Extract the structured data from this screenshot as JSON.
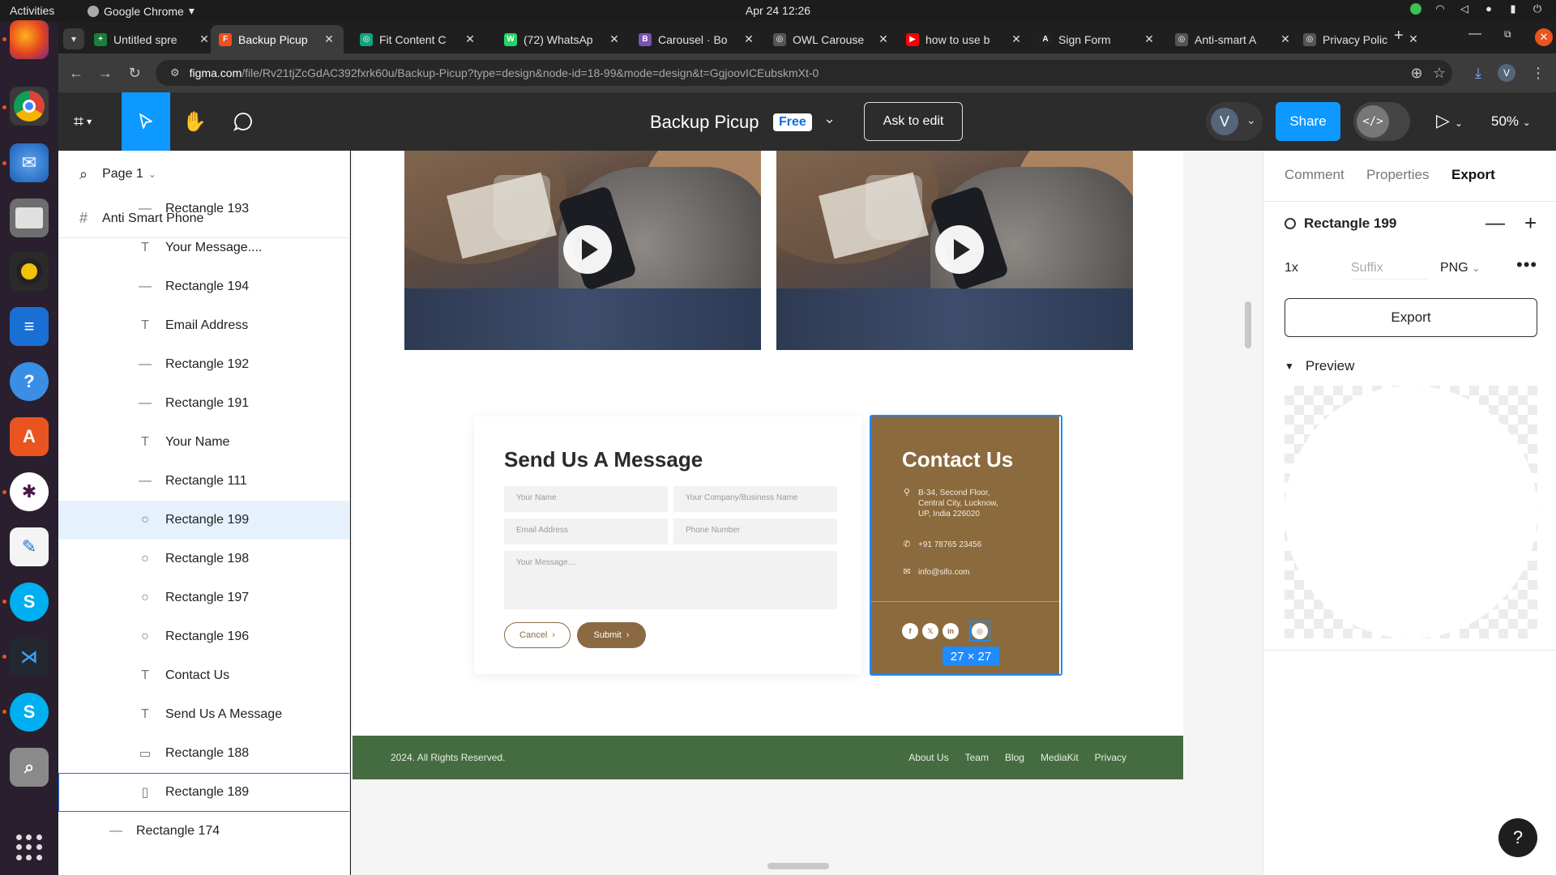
{
  "topbar": {
    "activities": "Activities",
    "app_name": "Google Chrome",
    "clock": "Apr 24  12:26"
  },
  "dock": {
    "items": [
      "firefox-icon",
      "chrome-icon",
      "thunderbird-icon",
      "files-icon",
      "rhythmbox-icon",
      "writer-icon",
      "help-icon",
      "software-icon",
      "slack-icon",
      "text-editor-icon",
      "skype-icon",
      "vscode-icon",
      "skype-icon",
      "search-icon"
    ]
  },
  "browser": {
    "tabs": [
      {
        "title": "Untitled spre",
        "color": "#188038",
        "glyph": "+"
      },
      {
        "title": "Backup Picup",
        "color": "#f24e1e",
        "glyph": "F",
        "active": true
      },
      {
        "title": "Fit Content C",
        "color": "#10a37f",
        "glyph": "◎"
      },
      {
        "title": "(72) WhatsAp",
        "color": "#25d366",
        "glyph": "W"
      },
      {
        "title": "Carousel · Bo",
        "color": "#7952b3",
        "glyph": "B"
      },
      {
        "title": "OWL Carouse",
        "color": "#555555",
        "glyph": "◎"
      },
      {
        "title": "how to use b",
        "color": "#ff0000",
        "glyph": "▶"
      },
      {
        "title": "Sign Form",
        "color": "#222222",
        "glyph": "A"
      },
      {
        "title": "Anti-smart A",
        "color": "#555555",
        "glyph": "◎"
      },
      {
        "title": "Privacy Polic",
        "color": "#555555",
        "glyph": "◎"
      }
    ],
    "url_host": "figma.com",
    "url_path": "/file/Rv21tjZcGdAC392fxrk60u/Backup-Picup?type=design&node-id=18-99&mode=design&t=GgjoovICEubskmXt-0",
    "profile_initial": "V"
  },
  "figma": {
    "file_title": "Backup Picup",
    "plan_badge": "Free",
    "ask_to_edit": "Ask to edit",
    "avatar_initial": "V",
    "share": "Share",
    "dev_mode": "</>",
    "zoom": "50%"
  },
  "layers": {
    "page": "Page 1",
    "frame": "Anti Smart Phone",
    "items": [
      {
        "name": "Rectangle 193",
        "type": "line"
      },
      {
        "name": "Your Message....",
        "type": "text"
      },
      {
        "name": "Rectangle 194",
        "type": "line"
      },
      {
        "name": "Email Address",
        "type": "text"
      },
      {
        "name": "Rectangle 192",
        "type": "line"
      },
      {
        "name": "Rectangle 191",
        "type": "line"
      },
      {
        "name": "Your Name",
        "type": "text"
      },
      {
        "name": "Rectangle 111",
        "type": "line"
      },
      {
        "name": "Rectangle 199",
        "type": "ellipse",
        "selected": true
      },
      {
        "name": "Rectangle 198",
        "type": "ellipse"
      },
      {
        "name": "Rectangle 197",
        "type": "ellipse"
      },
      {
        "name": "Rectangle 196",
        "type": "ellipse"
      },
      {
        "name": "Contact Us",
        "type": "text"
      },
      {
        "name": "Send Us A Message",
        "type": "text"
      },
      {
        "name": "Rectangle 188",
        "type": "rect"
      },
      {
        "name": "Rectangle 189",
        "type": "rect-tall",
        "outlined": true
      },
      {
        "name": "Rectangle 174",
        "type": "line",
        "shallow": true
      }
    ]
  },
  "design": {
    "form": {
      "title": "Send Us A Message",
      "name_placeholder": "Your Name",
      "company_placeholder": "Your Company/Business Name",
      "email_placeholder": "Email Address",
      "phone_placeholder": "Phone Number",
      "message_placeholder": "Your Message....",
      "cancel": "Cancel",
      "submit": "Submit"
    },
    "contact": {
      "title": "Contact Us",
      "address": "B-34, Second Floor,\nCentral City, Lucknow,\nUP, India 226020",
      "phone": "+91 78765 23456",
      "email": "info@sifo.com",
      "socials": [
        "f",
        "𝕏",
        "in",
        "◎"
      ],
      "size_badge": "27 × 27"
    },
    "footer": {
      "copyright": "2024. All Rights Reserved.",
      "links": [
        "About Us",
        "Team",
        "Blog",
        "MediaKit",
        "Privacy"
      ]
    },
    "colors": {
      "brown": "#8b6a3d",
      "footer_green": "#456c41",
      "figma_blue": "#0d99ff"
    }
  },
  "right_panel": {
    "tabs": [
      "Comment",
      "Properties",
      "Export"
    ],
    "active_tab": "Export",
    "layer_name": "Rectangle 199",
    "scale": "1x",
    "suffix_placeholder": "Suffix",
    "format": "PNG",
    "export_button": "Export",
    "preview_label": "Preview",
    "help": "?"
  }
}
